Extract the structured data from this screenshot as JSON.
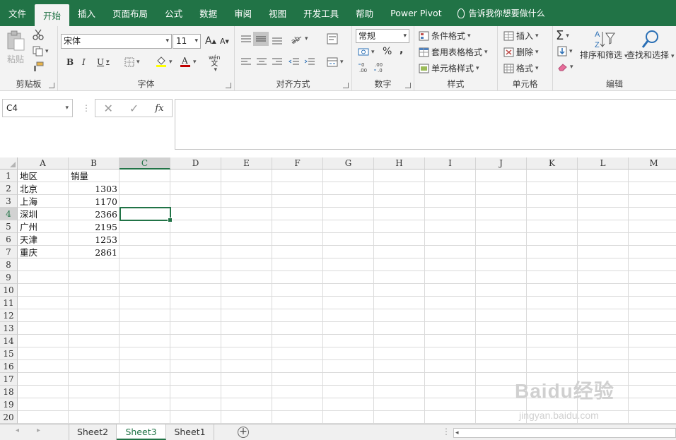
{
  "menu": {
    "items": [
      "文件",
      "开始",
      "插入",
      "页面布局",
      "公式",
      "数据",
      "审阅",
      "视图",
      "开发工具",
      "帮助",
      "Power Pivot"
    ],
    "active": "开始",
    "tell_me": "告诉我你想要做什么"
  },
  "ribbon": {
    "clipboard": {
      "label": "剪贴板",
      "paste": "粘贴"
    },
    "font": {
      "label": "字体",
      "font_name": "宋体",
      "font_size": "11",
      "bold": "B",
      "italic": "I",
      "underline": "U",
      "grow": "A",
      "shrink": "A",
      "phonetic_top": "wén",
      "phonetic_bottom": "文"
    },
    "alignment": {
      "label": "对齐方式"
    },
    "number": {
      "label": "数字",
      "format": "常规",
      "percent": "%",
      "comma": ","
    },
    "styles": {
      "label": "样式",
      "conditional": "条件格式",
      "table": "套用表格格式",
      "cell_styles": "单元格样式"
    },
    "cells": {
      "label": "单元格",
      "insert": "插入",
      "delete": "删除",
      "format": "格式"
    },
    "editing": {
      "label": "编辑",
      "sort_filter": "排序和筛选",
      "find_select": "查找和选择"
    },
    "colors": {
      "brand": "#217346",
      "fill_yellow": "#ffff00",
      "font_red": "#c00000"
    }
  },
  "formula_bar": {
    "name_box": "C4",
    "cancel": "✕",
    "enter": "✓",
    "fx": "fx",
    "content": ""
  },
  "grid": {
    "columns": [
      "A",
      "B",
      "C",
      "D",
      "E",
      "F",
      "G",
      "H",
      "I",
      "J",
      "K",
      "L",
      "M"
    ],
    "selected_column": "C",
    "rows": [
      "1",
      "2",
      "3",
      "4",
      "5",
      "6",
      "7",
      "8",
      "9",
      "10",
      "11",
      "12",
      "13",
      "14",
      "15",
      "16",
      "17",
      "18",
      "19",
      "20"
    ],
    "selected_row": "4",
    "cells": {
      "A1": "地区",
      "B1": "销量",
      "A2": "北京",
      "B2": "1303",
      "A3": "上海",
      "B3": "1170",
      "A4": "深圳",
      "B4": "2366",
      "A5": "广州",
      "B5": "2195",
      "A6": "天津",
      "B6": "1253",
      "A7": "重庆",
      "B7": "2861"
    }
  },
  "sheets": {
    "tabs": [
      "Sheet2",
      "Sheet3",
      "Sheet1"
    ],
    "active": "Sheet3",
    "add": "+"
  },
  "watermark": {
    "main": "Baidu经验",
    "sub": "jingyan.baidu.com"
  }
}
